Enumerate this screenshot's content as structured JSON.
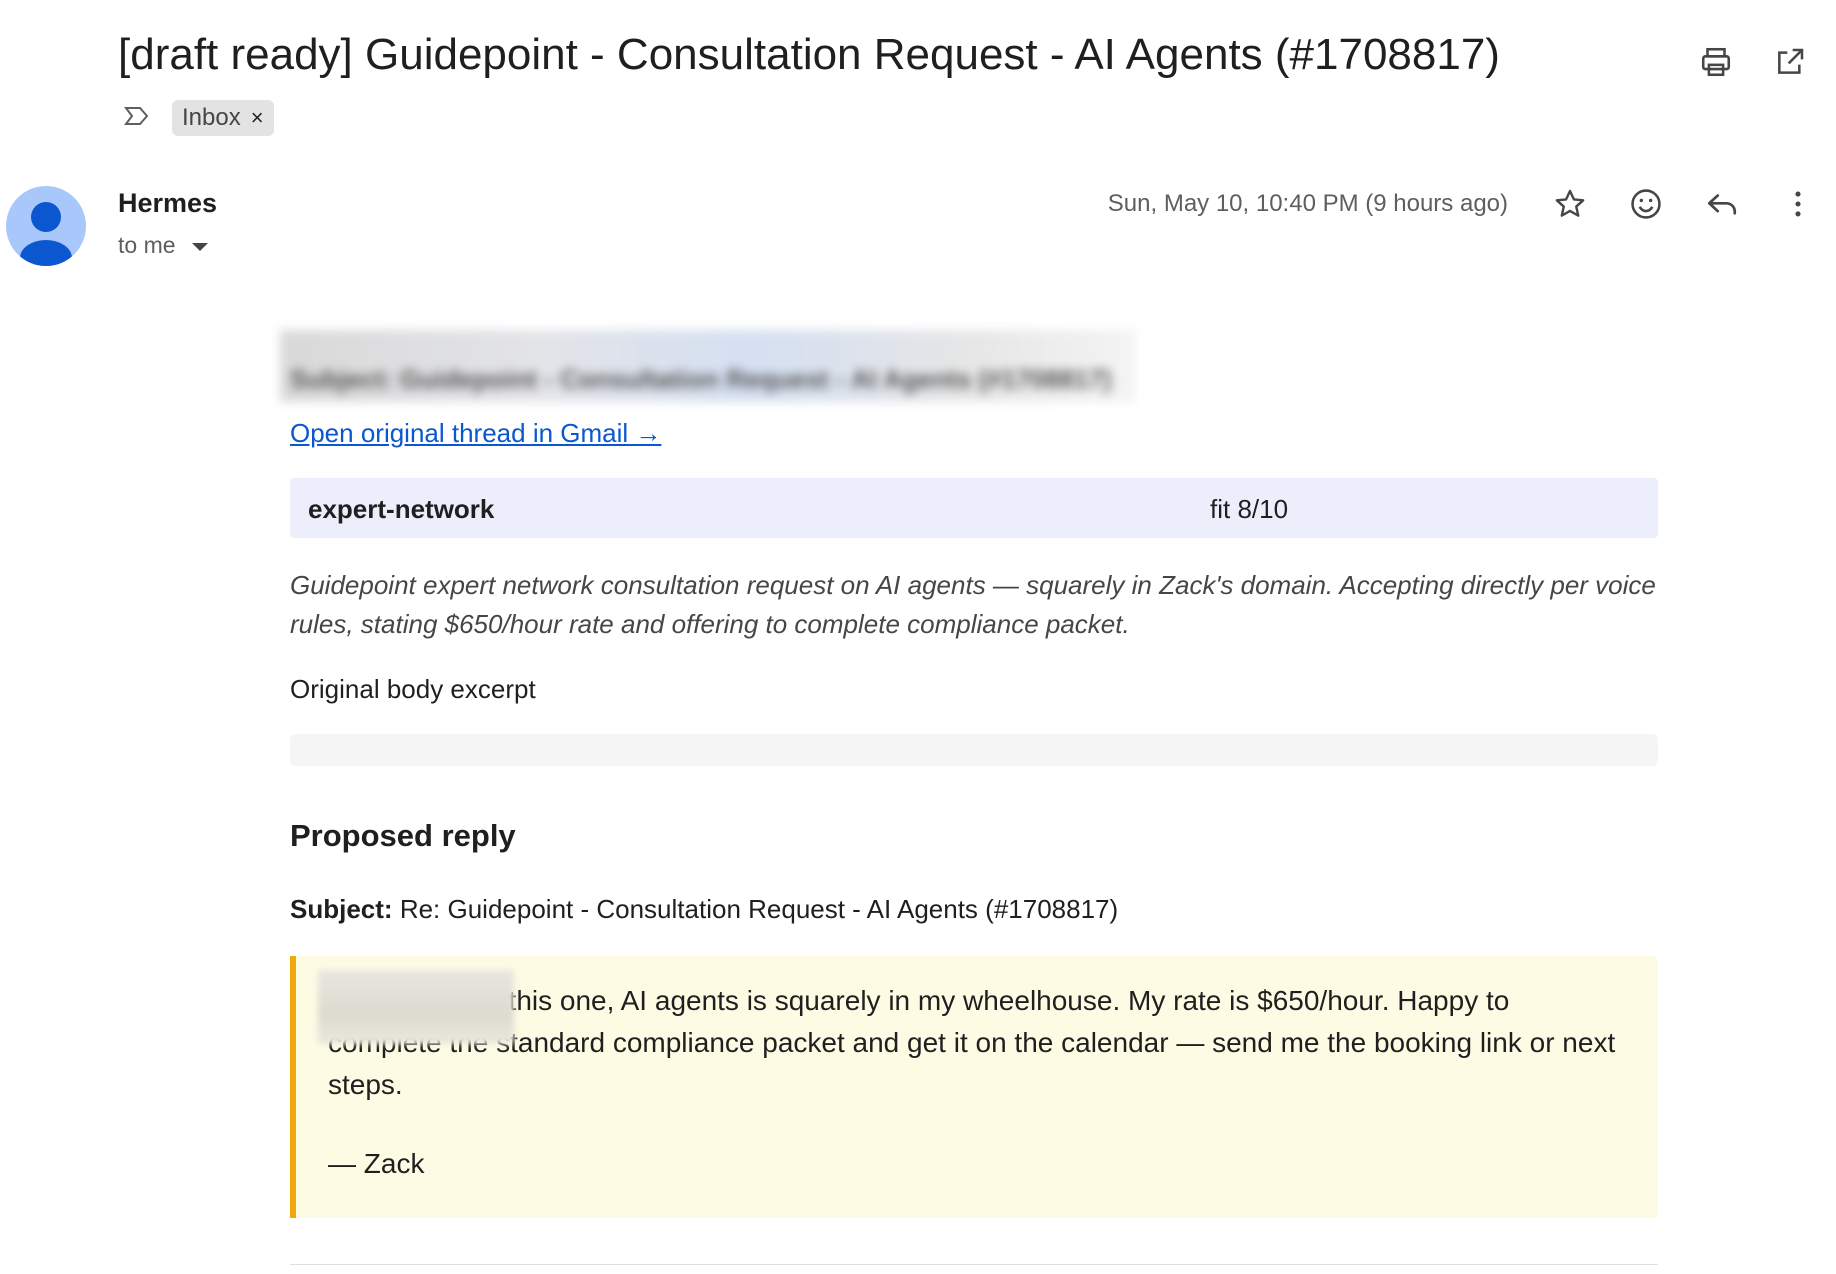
{
  "header": {
    "subject": "[draft ready] Guidepoint - Consultation Request - AI Agents (#1708817)",
    "label_chip": "Inbox",
    "label_remove": "×"
  },
  "icons": {
    "print": "printer-icon",
    "new_window": "open-in-new-window-icon",
    "important": "important-marker-icon",
    "star": "star-icon",
    "emoji": "emoji-reaction-icon",
    "reply": "reply-icon",
    "more": "more-vertical-icon",
    "avatar": "default-person-avatar-icon"
  },
  "message": {
    "sender": "Hermes",
    "to": "to me",
    "date": "Sun, May 10, 10:40 PM (9 hours ago)"
  },
  "body": {
    "blurred_line": "Subject: Guidepoint - Consultation Request - AI Agents (#1708817)",
    "thread_link": "Open original thread in Gmail →",
    "tag": "expert-network",
    "fit": "fit 8/10",
    "summary": "Guidepoint expert network consultation request on AI agents — squarely in Zack's domain. Accepting directly per voice rules, stating $650/hour rate and offering to complete compliance packet.",
    "excerpt_label": "Original body excerpt",
    "proposed_heading": "Proposed reply",
    "reply_subject_label": "Subject:",
    "reply_subject_value": "Re: Guidepoint - Consultation Request - AI Agents (#1708817)",
    "reply_text": "Happy to take this one, AI agents is squarely in my wheelhouse. My rate is $650/hour. Happy to complete the standard compliance packet and get it on the calendar — send me the booking link or next steps.",
    "reply_signature": "— Zack"
  },
  "colors": {
    "link": "#0b57d0",
    "tag_bar": "#eceefc",
    "reply_bg": "#fdfbe3",
    "reply_accent": "#f1a80a",
    "avatar_bg": "#a8c7fa",
    "avatar_fg": "#0b57d0"
  }
}
